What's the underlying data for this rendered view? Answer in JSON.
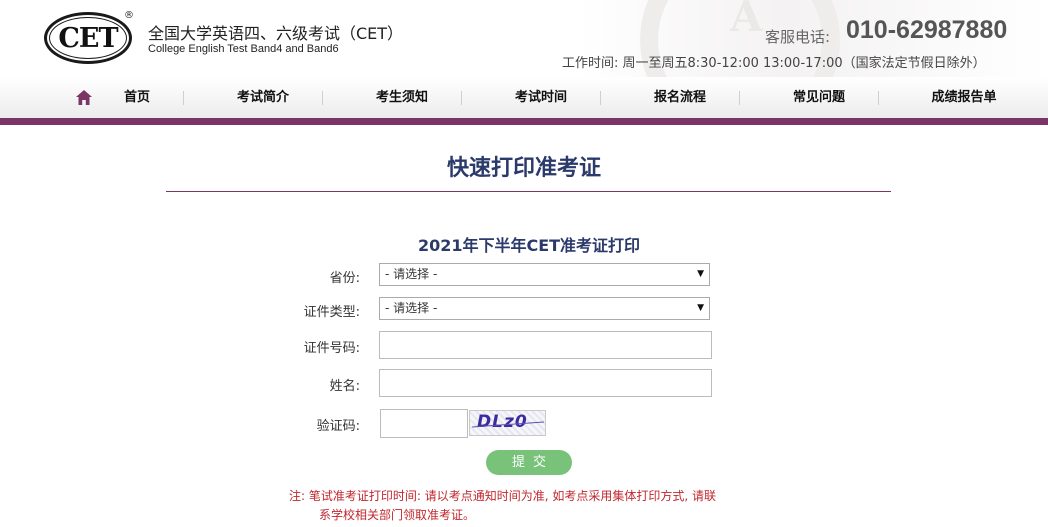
{
  "header": {
    "logo_text": "CET",
    "registered_mark": "®",
    "title_cn": "全国大学英语四、六级考试（CET）",
    "title_en": "College English Test Band4 and Band6",
    "phone_label": "客服电话:",
    "phone_number": "010-62987880",
    "hours": "工作时间: 周一至周五8:30-12:00 13:00-17:00（国家法定节假日除外）"
  },
  "nav": {
    "home_icon": "home-icon",
    "items": [
      "首页",
      "考试简介",
      "考生须知",
      "考试时间",
      "报名流程",
      "常见问题",
      "成绩报告单"
    ]
  },
  "main": {
    "page_title": "快速打印准考证",
    "form_title": "2021年下半年CET准考证打印",
    "fields": {
      "province_label": "省份:",
      "province_value": "- 请选择 -",
      "id_type_label": "证件类型:",
      "id_type_value": "- 请选择 -",
      "id_number_label": "证件号码:",
      "name_label": "姓名:",
      "captcha_label": "验证码:"
    },
    "captcha_text": "DLz0",
    "submit_label": "提交",
    "note_line1": "注: 笔试准考证打印时间: 请以考点通知时间为准, 如考点采用集体打印方式, 请联",
    "note_line2": "系学校相关部门领取准考证。"
  },
  "colors": {
    "brand_purple": "#7a3566",
    "title_navy": "#2b3a6b",
    "button_green": "#79c27a",
    "note_red": "#c0272d"
  }
}
